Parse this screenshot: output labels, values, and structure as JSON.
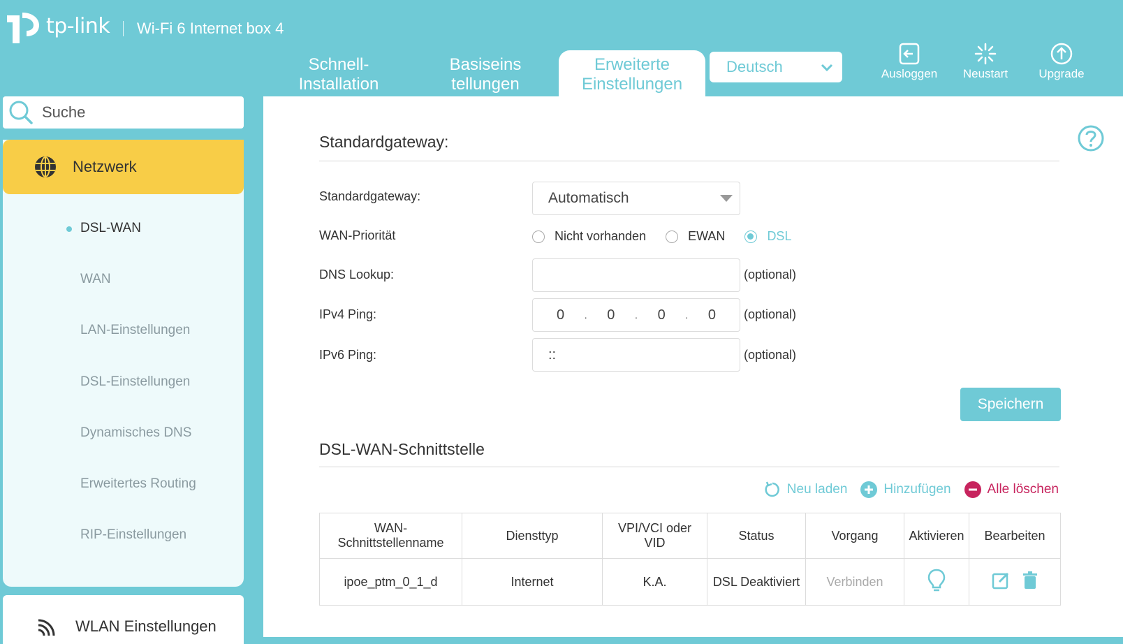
{
  "header": {
    "brand": "tp-link",
    "product": "Wi-Fi 6 Internet box 4",
    "tabs": [
      {
        "line1": "Schnell-",
        "line2": "Installation"
      },
      {
        "line1": "Basiseins",
        "line2": "tellungen"
      },
      {
        "line1": "Erweiterte",
        "line2": "Einstellungen"
      }
    ],
    "language": "Deutsch",
    "tools": {
      "logout": "Ausloggen",
      "reboot": "Neustart",
      "upgrade": "Upgrade"
    }
  },
  "sidebar": {
    "search_placeholder": "Suche",
    "section": "Netzwerk",
    "items": [
      "DSL-WAN",
      "WAN",
      "LAN-Einstellungen",
      "DSL-Einstellungen",
      "Dynamisches DNS",
      "Erweitertes Routing",
      "RIP-Einstellungen"
    ],
    "next_section": "WLAN Einstellungen"
  },
  "gateway": {
    "title": "Standardgateway:",
    "gateway_label": "Standardgateway:",
    "gateway_value": "Automatisch",
    "priority_label": "WAN-Priorität",
    "priority_options": [
      "Nicht vorhanden",
      "EWAN",
      "DSL"
    ],
    "dns_label": "DNS Lookup:",
    "dns_value": "",
    "ipv4_label": "IPv4 Ping:",
    "ipv4_segments": [
      "0",
      "0",
      "0",
      "0"
    ],
    "ipv6_label": "IPv6 Ping:",
    "ipv6_value": "::",
    "optional": "(optional)",
    "save": "Speichern"
  },
  "interface": {
    "title": "DSL-WAN-Schnittstelle",
    "actions": {
      "reload": "Neu laden",
      "add": "Hinzufügen",
      "delete_all": "Alle löschen"
    },
    "columns": [
      "WAN-\nSchnittstellenname",
      "Diensttyp",
      "VPI/VCI oder\nVID",
      "Status",
      "Vorgang",
      "Aktivieren",
      "Bearbeiten"
    ],
    "rows": [
      {
        "name": "ipoe_ptm_0_1_d",
        "service": "Internet",
        "vpi": "K.A.",
        "status": "DSL Deaktiviert",
        "action": "Verbinden"
      }
    ]
  },
  "colors": {
    "accent": "#6fcad6",
    "highlight": "#f8cd47",
    "danger": "#c7245e"
  }
}
